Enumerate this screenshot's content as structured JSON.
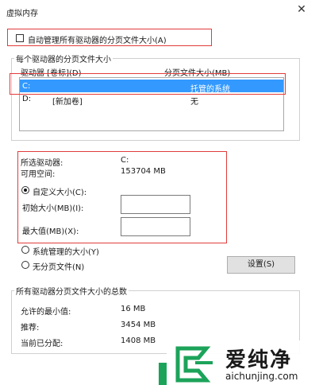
{
  "window": {
    "title": "虚拟内存",
    "close_glyph": "✕"
  },
  "auto_manage": {
    "label": "自动管理所有驱动器的分页文件大小(A)",
    "checked": false
  },
  "drive_group": {
    "label": "每个驱动器的分页文件大小",
    "col_drive": "驱动器 [卷标](D)",
    "col_size": "分页文件大小(MB)",
    "rows": [
      {
        "drive": "C:",
        "label": "",
        "size": "托管的系统",
        "selected": true
      },
      {
        "drive": "D:",
        "label": "[新加卷]",
        "size": "无",
        "selected": false
      }
    ]
  },
  "selected": {
    "drive_label": "所选驱动器:",
    "drive_value": "C:",
    "space_label": "可用空间:",
    "space_value": "153704 MB",
    "custom_label": "自定义大小(C):",
    "initial_label": "初始大小(MB)(I):",
    "initial_value": "",
    "max_label": "最大值(MB)(X):",
    "max_value": ""
  },
  "options": {
    "system_managed": "系统管理的大小(Y)",
    "no_paging": "无分页文件(N)",
    "set_button": "设置(S)"
  },
  "total_group": {
    "label": "所有驱动器分页文件大小的总数",
    "min_label": "允许的最小值:",
    "min_value": "16 MB",
    "rec_label": "推荐:",
    "rec_value": "3454 MB",
    "cur_label": "当前已分配:",
    "cur_value": "1408 MB"
  },
  "watermark": {
    "brand": "爱纯净",
    "url": "aichunjing.com"
  },
  "colors": {
    "accent_select": "#3399ff",
    "highlight_red": "#e23c3c",
    "watermark_green": "#1ca35a"
  }
}
